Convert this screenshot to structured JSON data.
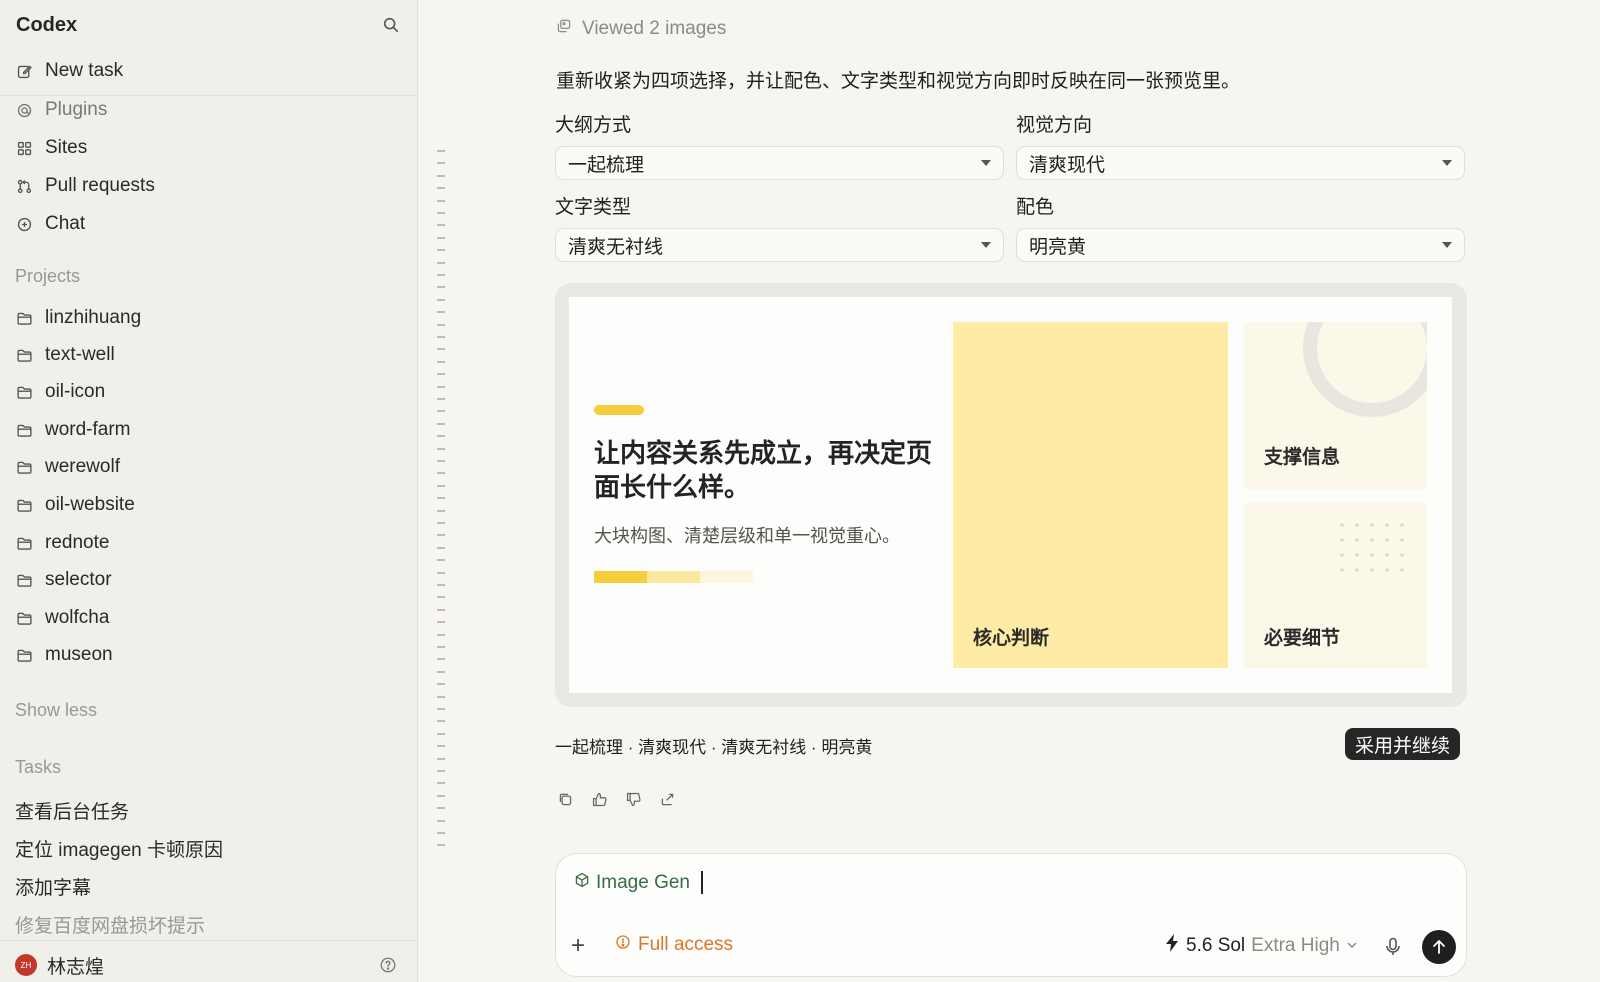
{
  "sidebar": {
    "app_title": "Codex",
    "nav": [
      {
        "label": "New task",
        "icon": "edit-icon"
      },
      {
        "label": "Plugins",
        "icon": "at-icon"
      },
      {
        "label": "Sites",
        "icon": "grid-icon"
      },
      {
        "label": "Pull requests",
        "icon": "pull-request-icon"
      },
      {
        "label": "Chat",
        "icon": "chat-plus-icon"
      }
    ],
    "projects_label": "Projects",
    "projects": [
      "linzhihuang",
      "text-well",
      "oil-icon",
      "word-farm",
      "werewolf",
      "oil-website",
      "rednote",
      "selector",
      "wolfcha",
      "museon"
    ],
    "show_less": "Show less",
    "tasks_label": "Tasks",
    "tasks": [
      "查看后台任务",
      "定位 imagegen 卡顿原因",
      "添加字幕",
      "修复百度网盘损坏提示"
    ],
    "user": {
      "name": "林志煌",
      "initials": "ZH"
    }
  },
  "main": {
    "viewed_images": "Viewed 2 images",
    "intro": "重新收紧为四项选择，并让配色、文字类型和视觉方向即时反映在同一张预览里。",
    "fields": {
      "outline": {
        "label": "大纲方式",
        "value": "一起梳理"
      },
      "visual": {
        "label": "视觉方向",
        "value": "清爽现代"
      },
      "type": {
        "label": "文字类型",
        "value": "清爽无衬线"
      },
      "color": {
        "label": "配色",
        "value": "明亮黄"
      }
    },
    "preview": {
      "heading": "让内容关系先成立，再决定页面长什么样。",
      "subheading": "大块构图、清楚层级和单一视觉重心。",
      "block_core": "核心判断",
      "block_support": "支撑信息",
      "block_detail": "必要细节",
      "accent_color": "#f6cd3a",
      "block_color": "#fdeba6"
    },
    "summary": "一起梳理 · 清爽现代 · 清爽无衬线 · 明亮黄",
    "primary_button": "采用并继续"
  },
  "composer": {
    "chip": "Image Gen",
    "access": "Full access",
    "model_name": "5.6 Sol",
    "model_effort": "Extra High"
  }
}
